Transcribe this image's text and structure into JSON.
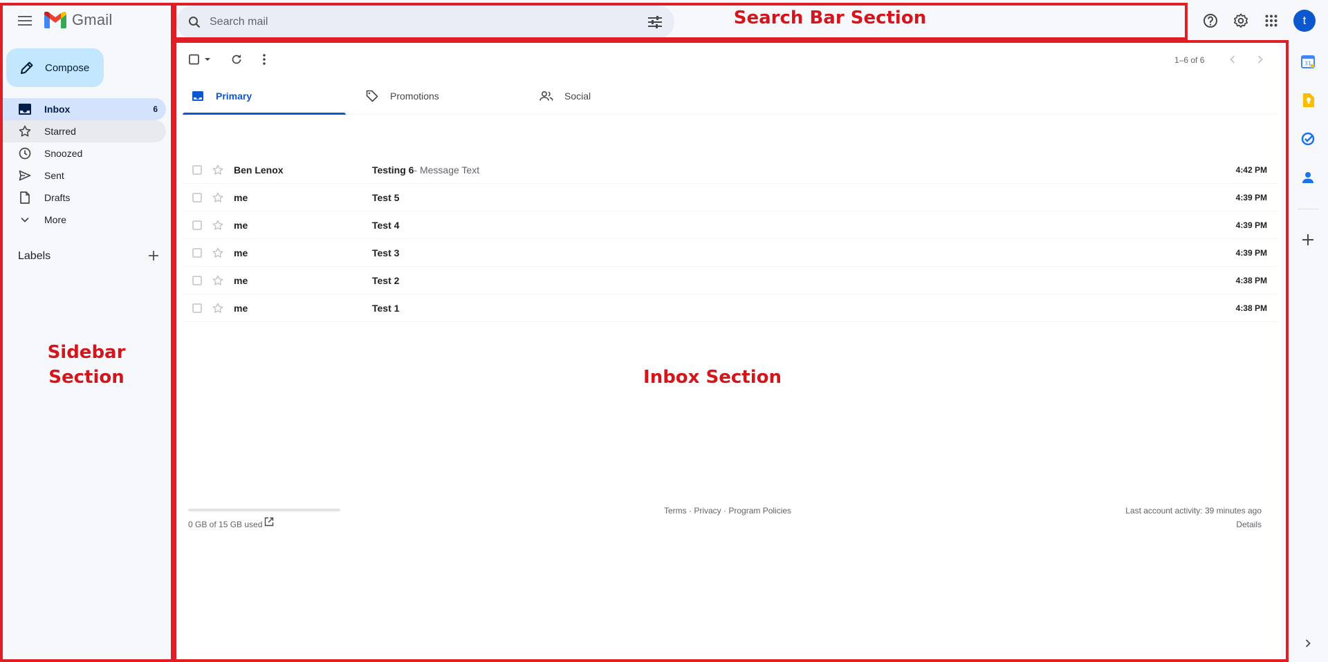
{
  "app": {
    "name": "Gmail"
  },
  "search": {
    "placeholder": "Search mail"
  },
  "header": {
    "avatar_letter": "t"
  },
  "sidebar": {
    "compose_label": "Compose",
    "items": [
      {
        "label": "Inbox",
        "count": "6",
        "icon": "inbox-icon"
      },
      {
        "label": "Starred",
        "count": "",
        "icon": "star-icon"
      },
      {
        "label": "Snoozed",
        "count": "",
        "icon": "clock-icon"
      },
      {
        "label": "Sent",
        "count": "",
        "icon": "send-icon"
      },
      {
        "label": "Drafts",
        "count": "",
        "icon": "draft-icon"
      },
      {
        "label": "More",
        "count": "",
        "icon": "chevron-down-icon"
      }
    ],
    "labels_title": "Labels"
  },
  "toolbar": {
    "page_info": "1–6 of 6"
  },
  "tabs": [
    {
      "label": "Primary",
      "icon": "inbox-icon"
    },
    {
      "label": "Promotions",
      "icon": "tag-icon"
    },
    {
      "label": "Social",
      "icon": "people-icon"
    }
  ],
  "emails": [
    {
      "sender": "Ben Lenox",
      "subject": "Testing 6",
      "snippet": " - Message Text",
      "time": "4:42 PM"
    },
    {
      "sender": "me",
      "subject": "Test 5",
      "snippet": "",
      "time": "4:39 PM"
    },
    {
      "sender": "me",
      "subject": "Test 4",
      "snippet": "",
      "time": "4:39 PM"
    },
    {
      "sender": "me",
      "subject": "Test 3",
      "snippet": "",
      "time": "4:39 PM"
    },
    {
      "sender": "me",
      "subject": "Test 2",
      "snippet": "",
      "time": "4:38 PM"
    },
    {
      "sender": "me",
      "subject": "Test 1",
      "snippet": "",
      "time": "4:38 PM"
    }
  ],
  "footer": {
    "storage": "0 GB of 15 GB used",
    "storage_fraction": 0,
    "terms": "Terms",
    "separator": " · ",
    "privacy": "Privacy",
    "policies": "Program Policies",
    "last_activity": "Last account activity: 39 minutes ago",
    "details": "Details"
  },
  "annotations": {
    "search": "Search Bar Section",
    "sidebar_line1": "Sidebar",
    "sidebar_line2": "Section",
    "inbox": "Inbox Section",
    "color": "#e01e25"
  },
  "colors": {
    "accent": "#0b57d0",
    "compose_bg": "#c2e7ff",
    "active_nav": "#d3e3fd",
    "page_bg": "#f6f8fc"
  }
}
